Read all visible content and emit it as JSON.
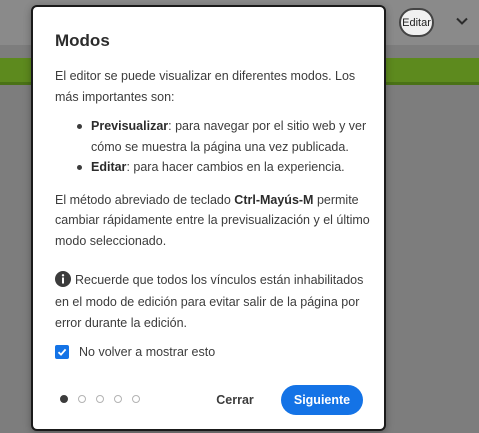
{
  "background": {
    "mode_toggle_label": "Editar",
    "colors": {
      "green_bar": "#5d8a1e",
      "overlay": "#7d7d7d"
    }
  },
  "dialog": {
    "title": "Modos",
    "intro": "El editor se puede visualizar en diferentes modos. Los más importantes son:",
    "modes": [
      {
        "name": "Previsualizar",
        "description": ": para navegar por el sitio web y ver cómo se muestra la página una vez publicada."
      },
      {
        "name": "Editar",
        "description": ": para hacer cambios en la experiencia."
      }
    ],
    "shortcut": {
      "before": "El método abreviado de teclado ",
      "keys": "Ctrl-Mayús-M",
      "after": " permite cambiar rápidamente entre la previsualización y el último modo seleccionado."
    },
    "note": "Recuerde que todos los vínculos están inhabilitados en el modo de edición para evitar salir de la página por error durante la edición.",
    "checkbox": {
      "label": "No volver a mostrar esto",
      "checked": true
    },
    "pagination": {
      "total": 5,
      "current": 1
    },
    "buttons": {
      "close": "Cerrar",
      "next": "Siguiente"
    },
    "colors": {
      "accent": "#1473e6",
      "text": "#3c3c3c"
    },
    "icons": {
      "info": "info-icon",
      "check": "check-icon",
      "chevron": "chevron-down-icon"
    }
  }
}
